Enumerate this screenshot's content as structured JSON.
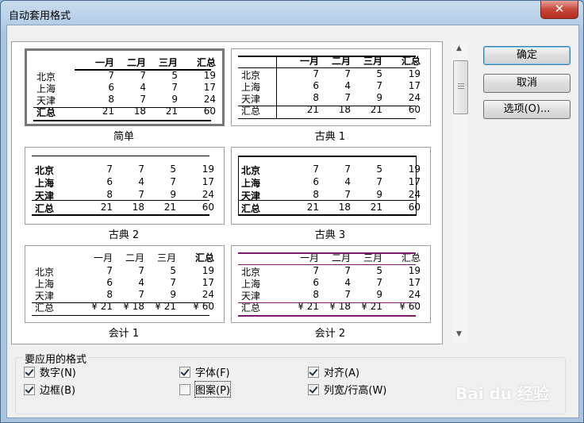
{
  "window": {
    "title": "自动套用格式",
    "close_label": "✕"
  },
  "buttons": {
    "ok": "确定",
    "cancel": "取消",
    "options": "选项(O)..."
  },
  "formats": [
    {
      "caption": "简单",
      "selected": true
    },
    {
      "caption": "古典 1",
      "selected": false
    },
    {
      "caption": "古典 2",
      "selected": false
    },
    {
      "caption": "古典 3",
      "selected": false
    },
    {
      "caption": "会计 1",
      "selected": false
    },
    {
      "caption": "会计 2",
      "selected": false
    }
  ],
  "sample": {
    "headers": [
      "一月",
      "二月",
      "三月",
      "汇总"
    ],
    "rows": [
      {
        "label": "北京",
        "values": [
          "7",
          "7",
          "5",
          "19"
        ]
      },
      {
        "label": "上海",
        "values": [
          "6",
          "4",
          "7",
          "17"
        ]
      },
      {
        "label": "天津",
        "values": [
          "8",
          "7",
          "9",
          "24"
        ]
      },
      {
        "label": "汇总",
        "values": [
          "21",
          "18",
          "21",
          "60"
        ]
      }
    ],
    "currency": "¥"
  },
  "apply_group": {
    "label": "要应用的格式",
    "options": [
      {
        "label": "数字(N)",
        "checked": true
      },
      {
        "label": "字体(F)",
        "checked": true
      },
      {
        "label": "对齐(A)",
        "checked": true
      },
      {
        "label": "边框(B)",
        "checked": true
      },
      {
        "label": "图案(P)",
        "checked": false
      },
      {
        "label": "列宽/行高(W)",
        "checked": true
      }
    ]
  },
  "watermark": "Bai du 经验"
}
